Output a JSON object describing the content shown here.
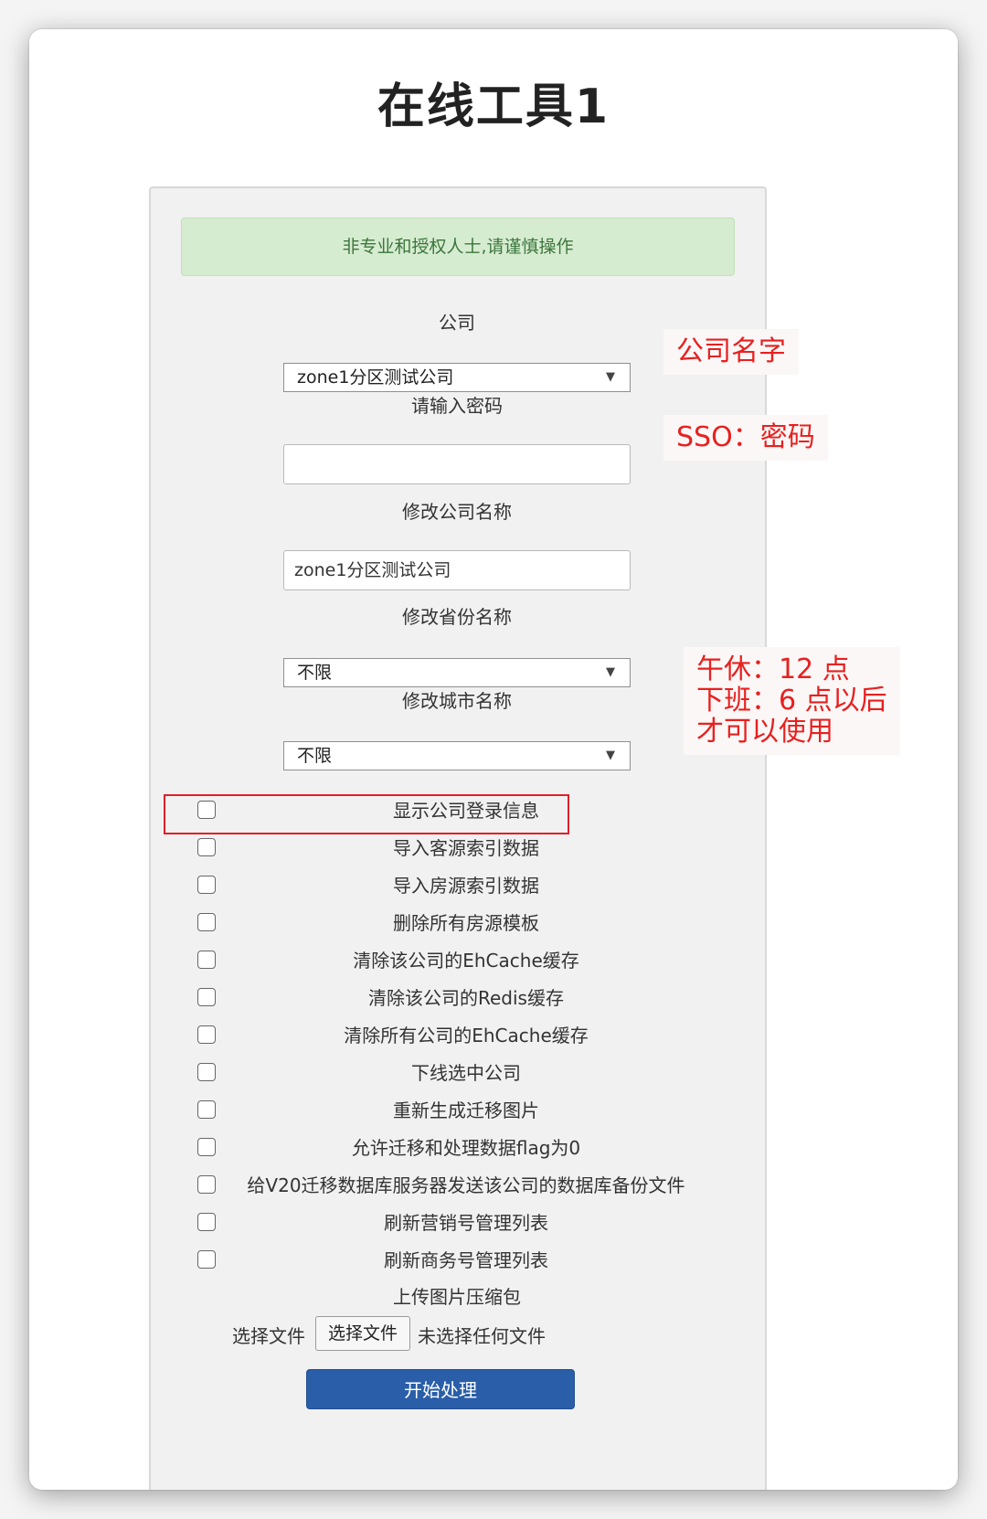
{
  "page_title": "在线工具1",
  "alert": "非专业和授权人士,请谨慎操作",
  "company": {
    "label": "公司",
    "selected": "zone1分区测试公司",
    "caret": "▼"
  },
  "password": {
    "label": "请输入密码",
    "value": ""
  },
  "rename_company": {
    "label": "修改公司名称",
    "value": "zone1分区测试公司"
  },
  "province": {
    "label": "修改省份名称",
    "selected": "不限",
    "caret": "▼"
  },
  "city": {
    "label": "修改城市名称",
    "selected": "不限",
    "caret": "▼"
  },
  "options": [
    {
      "label": "显示公司登录信息",
      "checked": false
    },
    {
      "label": "导入客源索引数据",
      "checked": false
    },
    {
      "label": "导入房源索引数据",
      "checked": false
    },
    {
      "label": "删除所有房源模板",
      "checked": false
    },
    {
      "label": "清除该公司的EhCache缓存",
      "checked": false
    },
    {
      "label": "清除该公司的Redis缓存",
      "checked": false
    },
    {
      "label": "清除所有公司的EhCache缓存",
      "checked": false
    },
    {
      "label": "下线选中公司",
      "checked": false
    },
    {
      "label": "重新生成迁移图片",
      "checked": false
    },
    {
      "label": "允许迁移和处理数据flag为0",
      "checked": false
    },
    {
      "label": "给V20迁移数据库服务器发送该公司的数据库备份文件",
      "checked": false
    },
    {
      "label": "刷新营销号管理列表",
      "checked": false
    },
    {
      "label": "刷新商务号管理列表",
      "checked": false
    }
  ],
  "upload": {
    "label": "上传图片压缩包",
    "prefix": "选择文件",
    "button": "选择文件",
    "status": "未选择任何文件"
  },
  "submit_label": "开始处理",
  "annotations": {
    "company_note": "公司名字",
    "password_note": "SSO：密码",
    "time_note_1": "午休：12 点",
    "time_note_2": "下班：6 点以后",
    "time_note_3": "才可以使用",
    "highlight_color": "#e0202a"
  }
}
